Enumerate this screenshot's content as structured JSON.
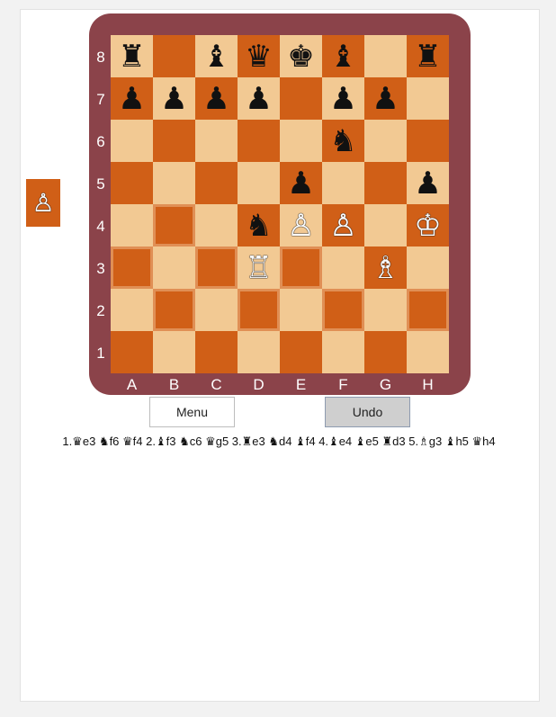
{
  "colors": {
    "frame": "#8b434a",
    "light_square": "#f2c993",
    "dark_square": "#d05f17",
    "label": "#ffffff"
  },
  "board": {
    "files": [
      "A",
      "B",
      "C",
      "D",
      "E",
      "F",
      "G",
      "H"
    ],
    "ranks": [
      "8",
      "7",
      "6",
      "5",
      "4",
      "3",
      "2",
      "1"
    ],
    "rows": [
      [
        {
          "glyph": "♜",
          "color": "black",
          "name": "rook"
        },
        {
          "glyph": "",
          "color": "",
          "name": ""
        },
        {
          "glyph": "♝",
          "color": "black",
          "name": "bishop"
        },
        {
          "glyph": "♛",
          "color": "black",
          "name": "queen"
        },
        {
          "glyph": "♚",
          "color": "black",
          "name": "king"
        },
        {
          "glyph": "♝",
          "color": "black",
          "name": "bishop"
        },
        {
          "glyph": "",
          "color": "",
          "name": ""
        },
        {
          "glyph": "♜",
          "color": "black",
          "name": "rook"
        }
      ],
      [
        {
          "glyph": "♟",
          "color": "black",
          "name": "pawn"
        },
        {
          "glyph": "♟",
          "color": "black",
          "name": "pawn"
        },
        {
          "glyph": "♟",
          "color": "black",
          "name": "pawn"
        },
        {
          "glyph": "♟",
          "color": "black",
          "name": "pawn"
        },
        {
          "glyph": "",
          "color": "",
          "name": ""
        },
        {
          "glyph": "♟",
          "color": "black",
          "name": "pawn"
        },
        {
          "glyph": "♟",
          "color": "black",
          "name": "pawn"
        },
        {
          "glyph": "",
          "color": "",
          "name": ""
        }
      ],
      [
        {
          "glyph": "",
          "color": "",
          "name": ""
        },
        {
          "glyph": "",
          "color": "",
          "name": ""
        },
        {
          "glyph": "",
          "color": "",
          "name": ""
        },
        {
          "glyph": "",
          "color": "",
          "name": ""
        },
        {
          "glyph": "",
          "color": "",
          "name": ""
        },
        {
          "glyph": "♞",
          "color": "black",
          "name": "knight"
        },
        {
          "glyph": "",
          "color": "",
          "name": ""
        },
        {
          "glyph": "",
          "color": "",
          "name": ""
        }
      ],
      [
        {
          "glyph": "",
          "color": "",
          "name": ""
        },
        {
          "glyph": "",
          "color": "",
          "name": ""
        },
        {
          "glyph": "",
          "color": "",
          "name": ""
        },
        {
          "glyph": "",
          "color": "",
          "name": ""
        },
        {
          "glyph": "♟",
          "color": "black",
          "name": "pawn"
        },
        {
          "glyph": "",
          "color": "",
          "name": ""
        },
        {
          "glyph": "",
          "color": "",
          "name": ""
        },
        {
          "glyph": "♟",
          "color": "black",
          "name": "pawn"
        }
      ],
      [
        {
          "glyph": "",
          "color": "",
          "name": ""
        },
        {
          "glyph": "",
          "color": "",
          "name": ""
        },
        {
          "glyph": "",
          "color": "",
          "name": ""
        },
        {
          "glyph": "♞",
          "color": "black",
          "name": "knight"
        },
        {
          "glyph": "♙",
          "color": "white",
          "name": "pawn"
        },
        {
          "glyph": "♙",
          "color": "white",
          "name": "pawn"
        },
        {
          "glyph": "",
          "color": "",
          "name": ""
        },
        {
          "glyph": "♔",
          "color": "white",
          "name": "king"
        }
      ],
      [
        {
          "glyph": "",
          "color": "",
          "name": ""
        },
        {
          "glyph": "",
          "color": "",
          "name": ""
        },
        {
          "glyph": "",
          "color": "",
          "name": ""
        },
        {
          "glyph": "♖",
          "color": "white",
          "name": "rook"
        },
        {
          "glyph": "",
          "color": "",
          "name": ""
        },
        {
          "glyph": "",
          "color": "",
          "name": ""
        },
        {
          "glyph": "♗",
          "color": "white",
          "name": "bishop"
        },
        {
          "glyph": "",
          "color": "",
          "name": ""
        }
      ],
      [
        {
          "glyph": "",
          "color": "",
          "name": ""
        },
        {
          "glyph": "",
          "color": "",
          "name": ""
        },
        {
          "glyph": "",
          "color": "",
          "name": ""
        },
        {
          "glyph": "",
          "color": "",
          "name": ""
        },
        {
          "glyph": "",
          "color": "",
          "name": ""
        },
        {
          "glyph": "",
          "color": "",
          "name": ""
        },
        {
          "glyph": "",
          "color": "",
          "name": ""
        },
        {
          "glyph": "",
          "color": "",
          "name": ""
        }
      ],
      [
        {
          "glyph": "",
          "color": "",
          "name": ""
        },
        {
          "glyph": "",
          "color": "",
          "name": ""
        },
        {
          "glyph": "",
          "color": "",
          "name": ""
        },
        {
          "glyph": "",
          "color": "",
          "name": ""
        },
        {
          "glyph": "",
          "color": "",
          "name": ""
        },
        {
          "glyph": "",
          "color": "",
          "name": ""
        },
        {
          "glyph": "",
          "color": "",
          "name": ""
        },
        {
          "glyph": "",
          "color": "",
          "name": ""
        }
      ]
    ],
    "highlighted": [
      "a3",
      "b4",
      "e3",
      "d2",
      "h2",
      "f2",
      "b2",
      "c3"
    ]
  },
  "captured": [
    {
      "glyph": "♙",
      "color": "white",
      "name": "pawn"
    }
  ],
  "buttons": {
    "menu": "Menu",
    "undo": "Undo"
  },
  "moves": "1.♛e3 ♞f6 ♛f4 2.♝f3 ♞c6 ♛g5 3.♜e3 ♞d4 ♝f4 4.♝e4 ♝e5 ♜d3 5.♗g3 ♝h5 ♛h4"
}
